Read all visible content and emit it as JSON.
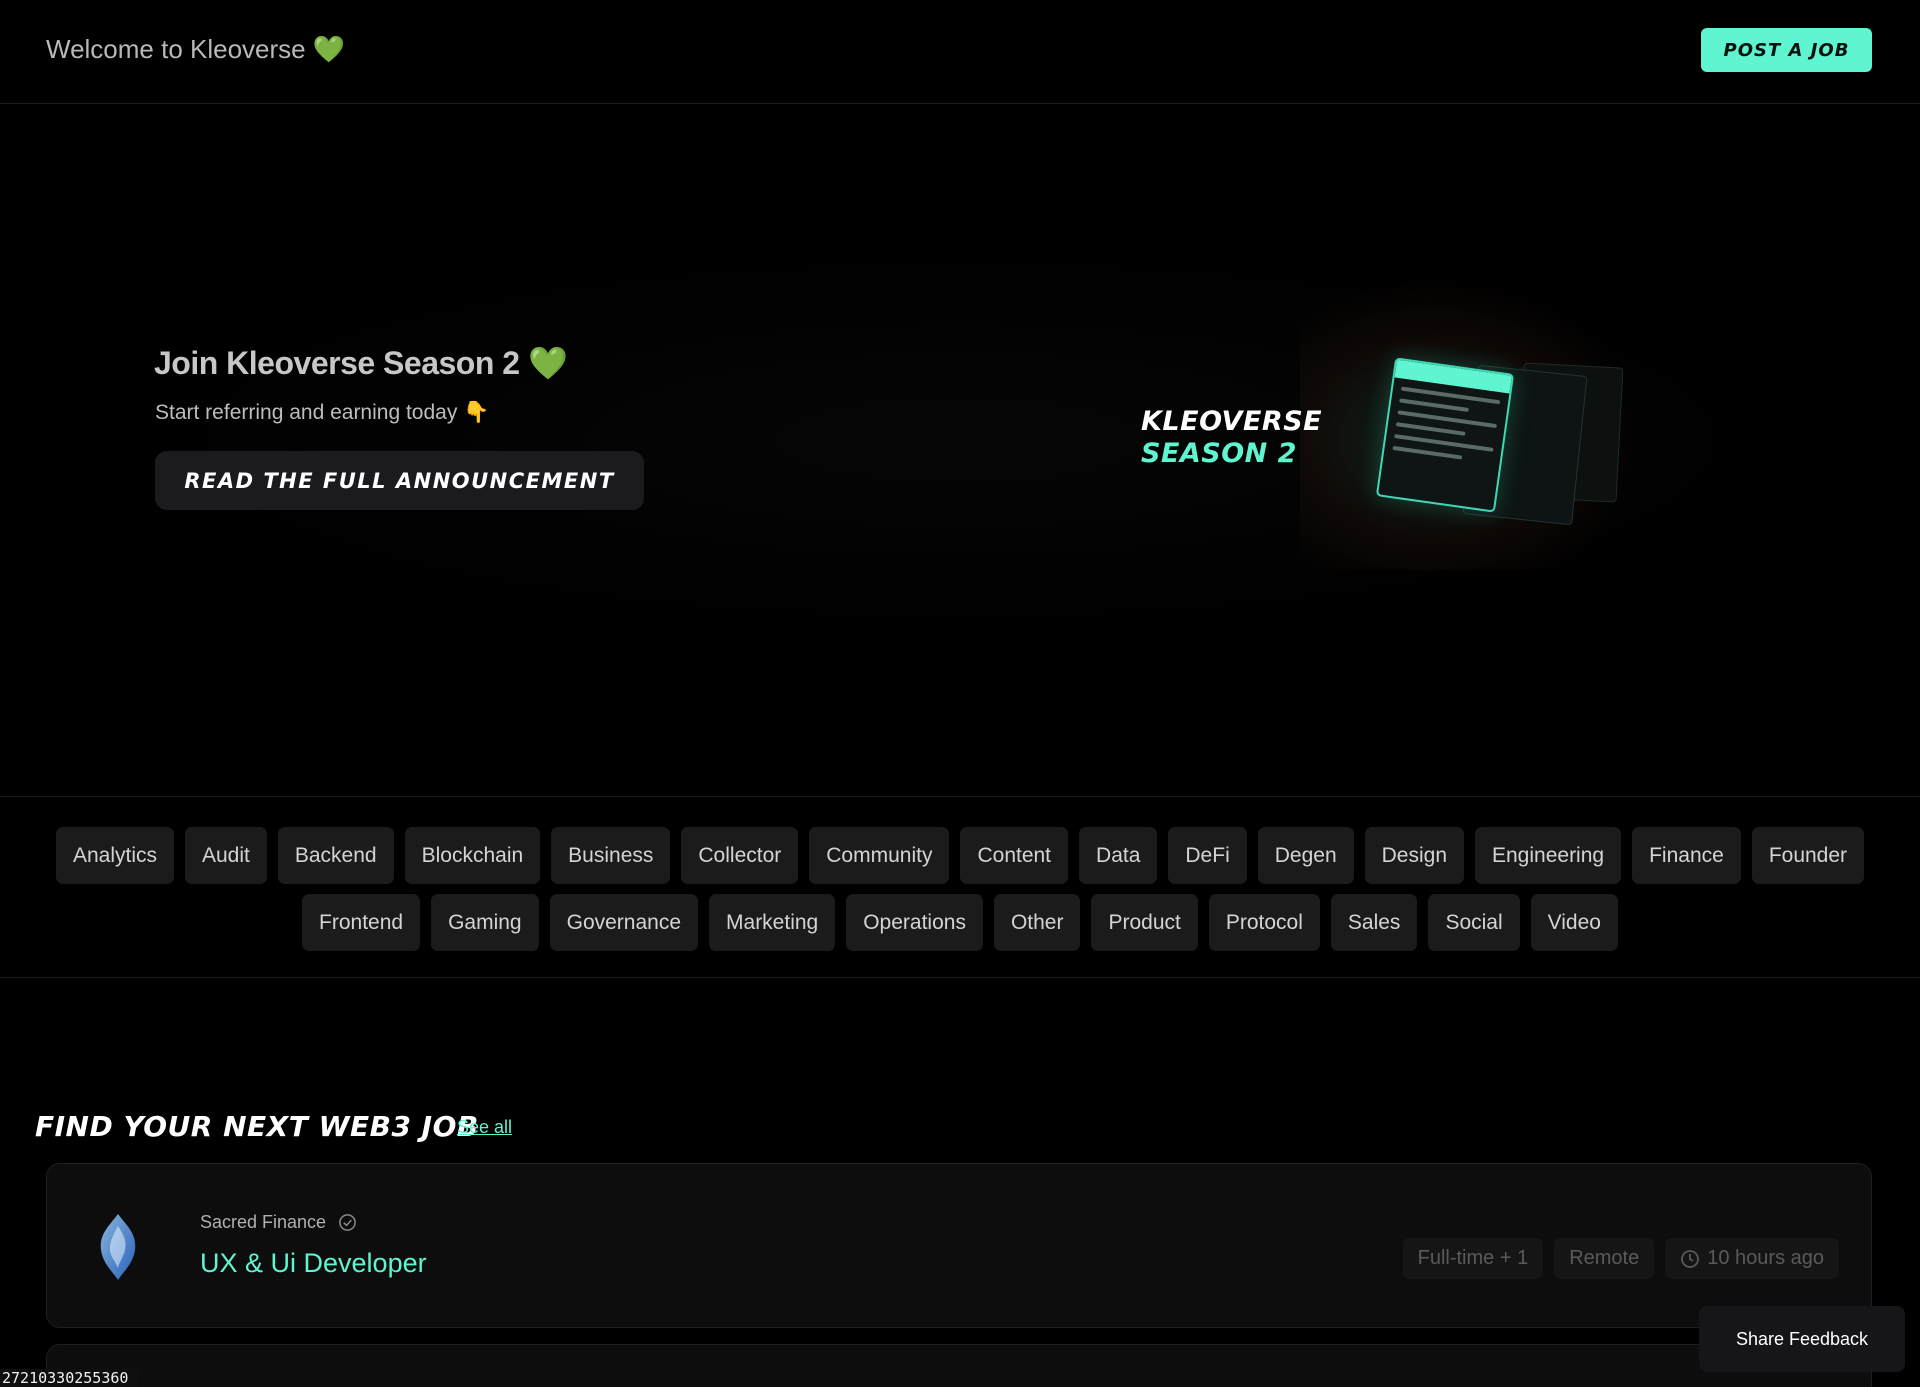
{
  "header": {
    "welcome": "Welcome to Kleoverse",
    "heart_emoji": "💚",
    "post_job_label": "POST A JOB"
  },
  "hero": {
    "title": "Join Kleoverse Season 2",
    "title_emoji": "💚",
    "subtitle": "Start referring and earning today",
    "subtitle_emoji": "👇",
    "button_label": "READ THE FULL ANNOUNCEMENT",
    "promo_line1": "KLEOVERSE",
    "promo_line2": "SEASON 2"
  },
  "categories": {
    "row1": [
      "Analytics",
      "Audit",
      "Backend",
      "Blockchain",
      "Business",
      "Collector",
      "Community",
      "Content",
      "Data",
      "DeFi",
      "Degen",
      "Design",
      "Engineering",
      "Finance",
      "Founder"
    ],
    "row2": [
      "Frontend",
      "Gaming",
      "Governance",
      "Marketing",
      "Operations",
      "Other",
      "Product",
      "Protocol",
      "Sales",
      "Social",
      "Video"
    ]
  },
  "jobs": {
    "heading": "FIND YOUR NEXT WEB3 JOB",
    "see_all": "See all",
    "items": [
      {
        "company": "Sacred Finance",
        "verified_icon": "check-circle-icon",
        "title": "UX & Ui Developer",
        "type": "Full-time + 1",
        "location": "Remote",
        "posted": "10 hours ago",
        "posted_icon": "clock-icon"
      }
    ]
  },
  "feedback_label": "Share Feedback",
  "footer_id": "27210330255360",
  "colors": {
    "accent": "#5ff5d0",
    "background": "#000000",
    "chip": "#1b1b1c"
  }
}
